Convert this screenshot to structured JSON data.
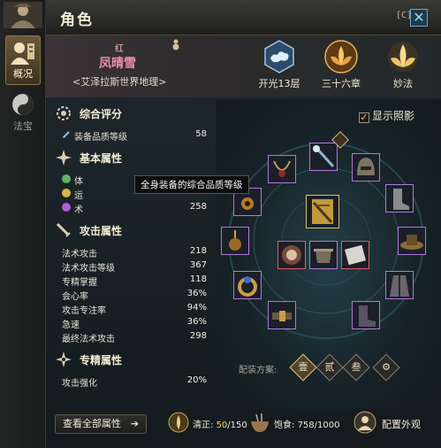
{
  "window": {
    "title": "角色",
    "hotkey": "[C]",
    "close_icon": "close-icon"
  },
  "tabs": [
    {
      "label": "概况",
      "icon": "overview-icon",
      "active": true
    },
    {
      "label": "法宝",
      "icon": "taiji-icon",
      "active": false
    }
  ],
  "character": {
    "rank": "红",
    "name": "凤晴雪",
    "server": "<艾泽拉斯世界地理>"
  },
  "badges": [
    {
      "label": "开光13层",
      "icon": "cloud-emblem-icon"
    },
    {
      "label": "三十六章",
      "icon": "lotus-emblem-icon"
    },
    {
      "label": "妙法",
      "icon": "lotus-light-icon"
    }
  ],
  "stats": {
    "overall": {
      "title": "综合评分",
      "rows": [
        {
          "key": "装备品质等级",
          "value": "58"
        }
      ]
    },
    "basic": {
      "title": "基本属性",
      "rows": [
        {
          "key": "体",
          "value": ""
        },
        {
          "key": "运",
          "value": ""
        },
        {
          "key": "术",
          "value": "258"
        }
      ]
    },
    "attack": {
      "title": "攻击属性",
      "rows": [
        {
          "key": "法术攻击",
          "value": "218"
        },
        {
          "key": "法术攻击等级",
          "value": "367"
        },
        {
          "key": "专精掌握",
          "value": "118"
        },
        {
          "key": "会心率",
          "value": "36%"
        },
        {
          "key": "攻击专注率",
          "value": "94%"
        },
        {
          "key": "急速",
          "value": "36%"
        },
        {
          "key": "最终法术攻击",
          "value": "298"
        }
      ]
    },
    "special": {
      "title": "专精属性",
      "rows": [
        {
          "key": "攻击强化",
          "value": "20%"
        }
      ]
    }
  },
  "tooltip": "全身装备的综合品质等级",
  "view_all_button": "查看全部属性",
  "view_all_arrow": "➔",
  "status": {
    "qingzheng_label": "清正:",
    "qingzheng_current": "50",
    "qingzheng_max": "/150",
    "baoshi_label": "饱食:",
    "baoshi_value": "758/1000"
  },
  "appearance_button": "配置外观",
  "show_skin": {
    "label": "显示照影",
    "checked": true
  },
  "loadout": {
    "label": "配装方案:",
    "plans": [
      "壹",
      "贰",
      "叁"
    ],
    "active_index": 0
  },
  "colors": {
    "accent_pink": "#ee8fb1",
    "slot_purple": "#b07ad8",
    "slot_gold": "#e0c060",
    "qingzheng_gold": "#f3d36c"
  }
}
